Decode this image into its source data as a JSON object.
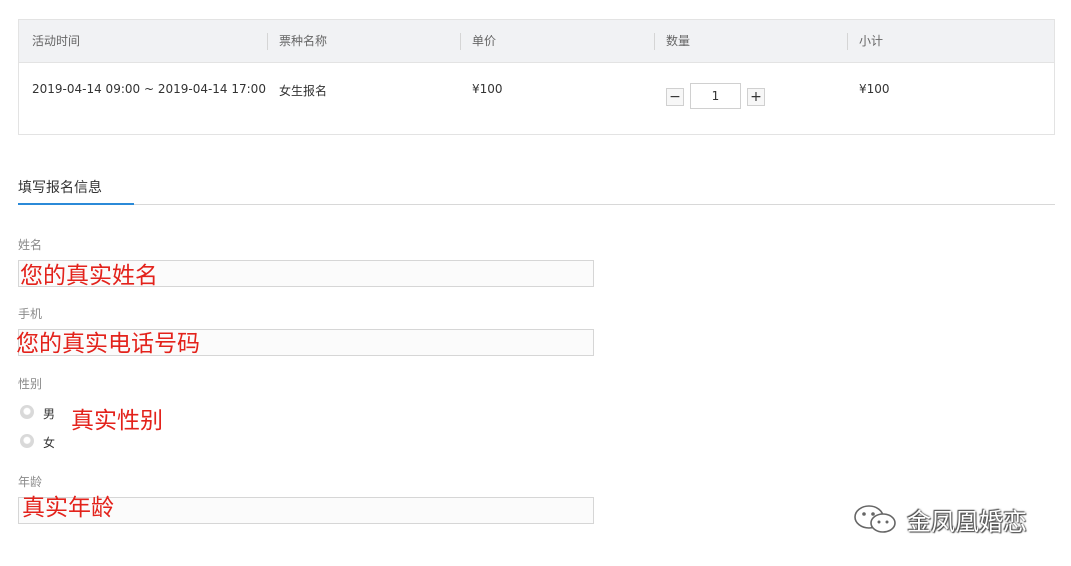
{
  "table": {
    "headers": [
      "活动时间",
      "票种名称",
      "单价",
      "数量",
      "小计"
    ],
    "row": {
      "time": "2019-04-14 09:00 ~ 2019-04-14 17:00",
      "ticket_name": "女生报名",
      "unit_price": "¥100",
      "quantity": "1",
      "subtotal": "¥100",
      "minus": "−",
      "plus": "+"
    }
  },
  "section": {
    "title": "填写报名信息"
  },
  "form": {
    "name_label": "姓名",
    "name_hint": "您的真实姓名",
    "phone_label": "手机",
    "phone_hint": "您的真实电话号码",
    "gender_label": "性别",
    "gender_options": [
      "男",
      "女"
    ],
    "gender_hint": "真实性别",
    "age_label": "年龄",
    "age_hint": "真实年龄"
  },
  "watermark": {
    "text": "金凤凰婚恋",
    "icon": "wechat-icon"
  },
  "colors": {
    "accent": "#2b8ad8",
    "annotation": "#e3221b",
    "header_bg": "#f1f2f4"
  }
}
